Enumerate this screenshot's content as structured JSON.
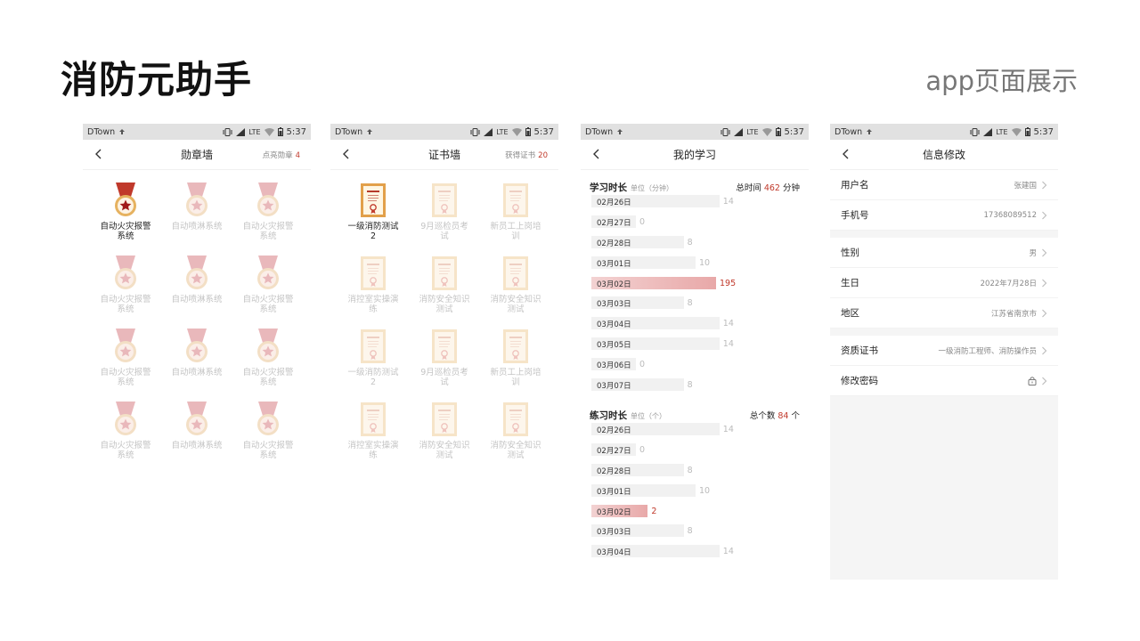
{
  "page": {
    "title": "消防元助手",
    "subtitle": "app页面展示"
  },
  "status": {
    "carrier": "DTown",
    "network": "LTE",
    "time": "5:37"
  },
  "colors": {
    "accent": "#c0392b",
    "medal_ribbon": "#e9b8bb",
    "medal_ring": "#f3dfc5",
    "cert_frame": "#f6e4c8"
  },
  "medal_wall": {
    "title": "勋章墙",
    "extra_label": "点亮勋章",
    "extra_value": "4",
    "items": [
      {
        "label": "自动火灾报警系统",
        "active": true
      },
      {
        "label": "自动喷淋系统",
        "active": false
      },
      {
        "label": "自动火灾报警系统",
        "active": false
      },
      {
        "label": "自动火灾报警系统",
        "active": false
      },
      {
        "label": "自动喷淋系统",
        "active": false
      },
      {
        "label": "自动火灾报警系统",
        "active": false
      },
      {
        "label": "自动火灾报警系统",
        "active": false
      },
      {
        "label": "自动喷淋系统",
        "active": false
      },
      {
        "label": "自动火灾报警系统",
        "active": false
      },
      {
        "label": "自动火灾报警系统",
        "active": false
      },
      {
        "label": "自动喷淋系统",
        "active": false
      },
      {
        "label": "自动火灾报警系统",
        "active": false
      }
    ]
  },
  "cert_wall": {
    "title": "证书墙",
    "extra_label": "获得证书",
    "extra_value": "20",
    "items": [
      {
        "label": "一级消防测试2",
        "active": true
      },
      {
        "label": "9月巡检员考试",
        "active": false
      },
      {
        "label": "新员工上岗培训",
        "active": false
      },
      {
        "label": "消控室实操演练",
        "active": false
      },
      {
        "label": "消防安全知识测试",
        "active": false
      },
      {
        "label": "消防安全知识测试",
        "active": false
      },
      {
        "label": "一级消防测试2",
        "active": false
      },
      {
        "label": "9月巡检员考试",
        "active": false
      },
      {
        "label": "新员工上岗培训",
        "active": false
      },
      {
        "label": "消控室实操演练",
        "active": false
      },
      {
        "label": "消防安全知识测试",
        "active": false
      },
      {
        "label": "消防安全知识测试",
        "active": false
      }
    ]
  },
  "study": {
    "title": "我的学习",
    "study_section": {
      "title": "学习时长",
      "unit": "单位（分钟）",
      "total_label": "总时间",
      "total_value": "462",
      "total_unit": "分钟"
    },
    "practice_section": {
      "title": "练习时长",
      "unit": "单位（个）",
      "total_label": "总个数",
      "total_value": "84",
      "total_unit": "个"
    }
  },
  "chart_data": [
    {
      "type": "bar",
      "title": "学习时长",
      "categories": [
        "02月26日",
        "02月27日",
        "02月28日",
        "03月01日",
        "03月02日",
        "03月03日",
        "03月04日",
        "03月05日",
        "03月06日",
        "03月07日"
      ],
      "values": [
        14,
        0,
        8,
        10,
        195,
        8,
        14,
        14,
        0,
        8
      ],
      "highlight_index": 4
    },
    {
      "type": "bar",
      "title": "练习时长",
      "categories": [
        "02月26日",
        "02月27日",
        "02月28日",
        "03月01日",
        "03月02日",
        "03月03日",
        "03月04日"
      ],
      "values": [
        14,
        0,
        8,
        10,
        2,
        8,
        14
      ],
      "highlight_index": 4
    }
  ],
  "info": {
    "title": "信息修改",
    "group1": [
      {
        "label": "用户名",
        "value": "张建国"
      },
      {
        "label": "手机号",
        "value": "17368089512"
      }
    ],
    "group2": [
      {
        "label": "性别",
        "value": "男"
      },
      {
        "label": "生日",
        "value": "2022年7月28日"
      },
      {
        "label": "地区",
        "value": "江苏省南京市"
      }
    ],
    "group3": [
      {
        "label": "资质证书",
        "value": "一级消防工程师、消防操作员"
      },
      {
        "label": "修改密码",
        "value": ""
      }
    ]
  }
}
